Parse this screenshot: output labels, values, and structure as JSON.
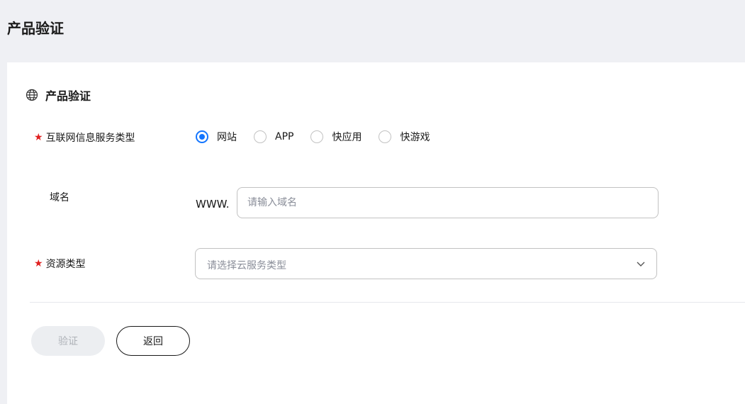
{
  "header": {
    "title": "产品验证"
  },
  "section": {
    "title": "产品验证",
    "icon": "globe-icon"
  },
  "form": {
    "service_type": {
      "label": "互联网信息服务类型",
      "required": true,
      "options": [
        {
          "label": "网站",
          "checked": true
        },
        {
          "label": "APP",
          "checked": false
        },
        {
          "label": "快应用",
          "checked": false
        },
        {
          "label": "快游戏",
          "checked": false
        }
      ]
    },
    "domain": {
      "label": "域名",
      "prefix": "WWW.",
      "placeholder": "请输入域名",
      "value": ""
    },
    "resource_type": {
      "label": "资源类型",
      "required": true,
      "placeholder": "请选择云服务类型"
    }
  },
  "actions": {
    "verify_label": "验证",
    "back_label": "返回"
  },
  "colors": {
    "accent": "#1476ff",
    "required": "#e02020",
    "header_bg": "#eff0f4"
  }
}
